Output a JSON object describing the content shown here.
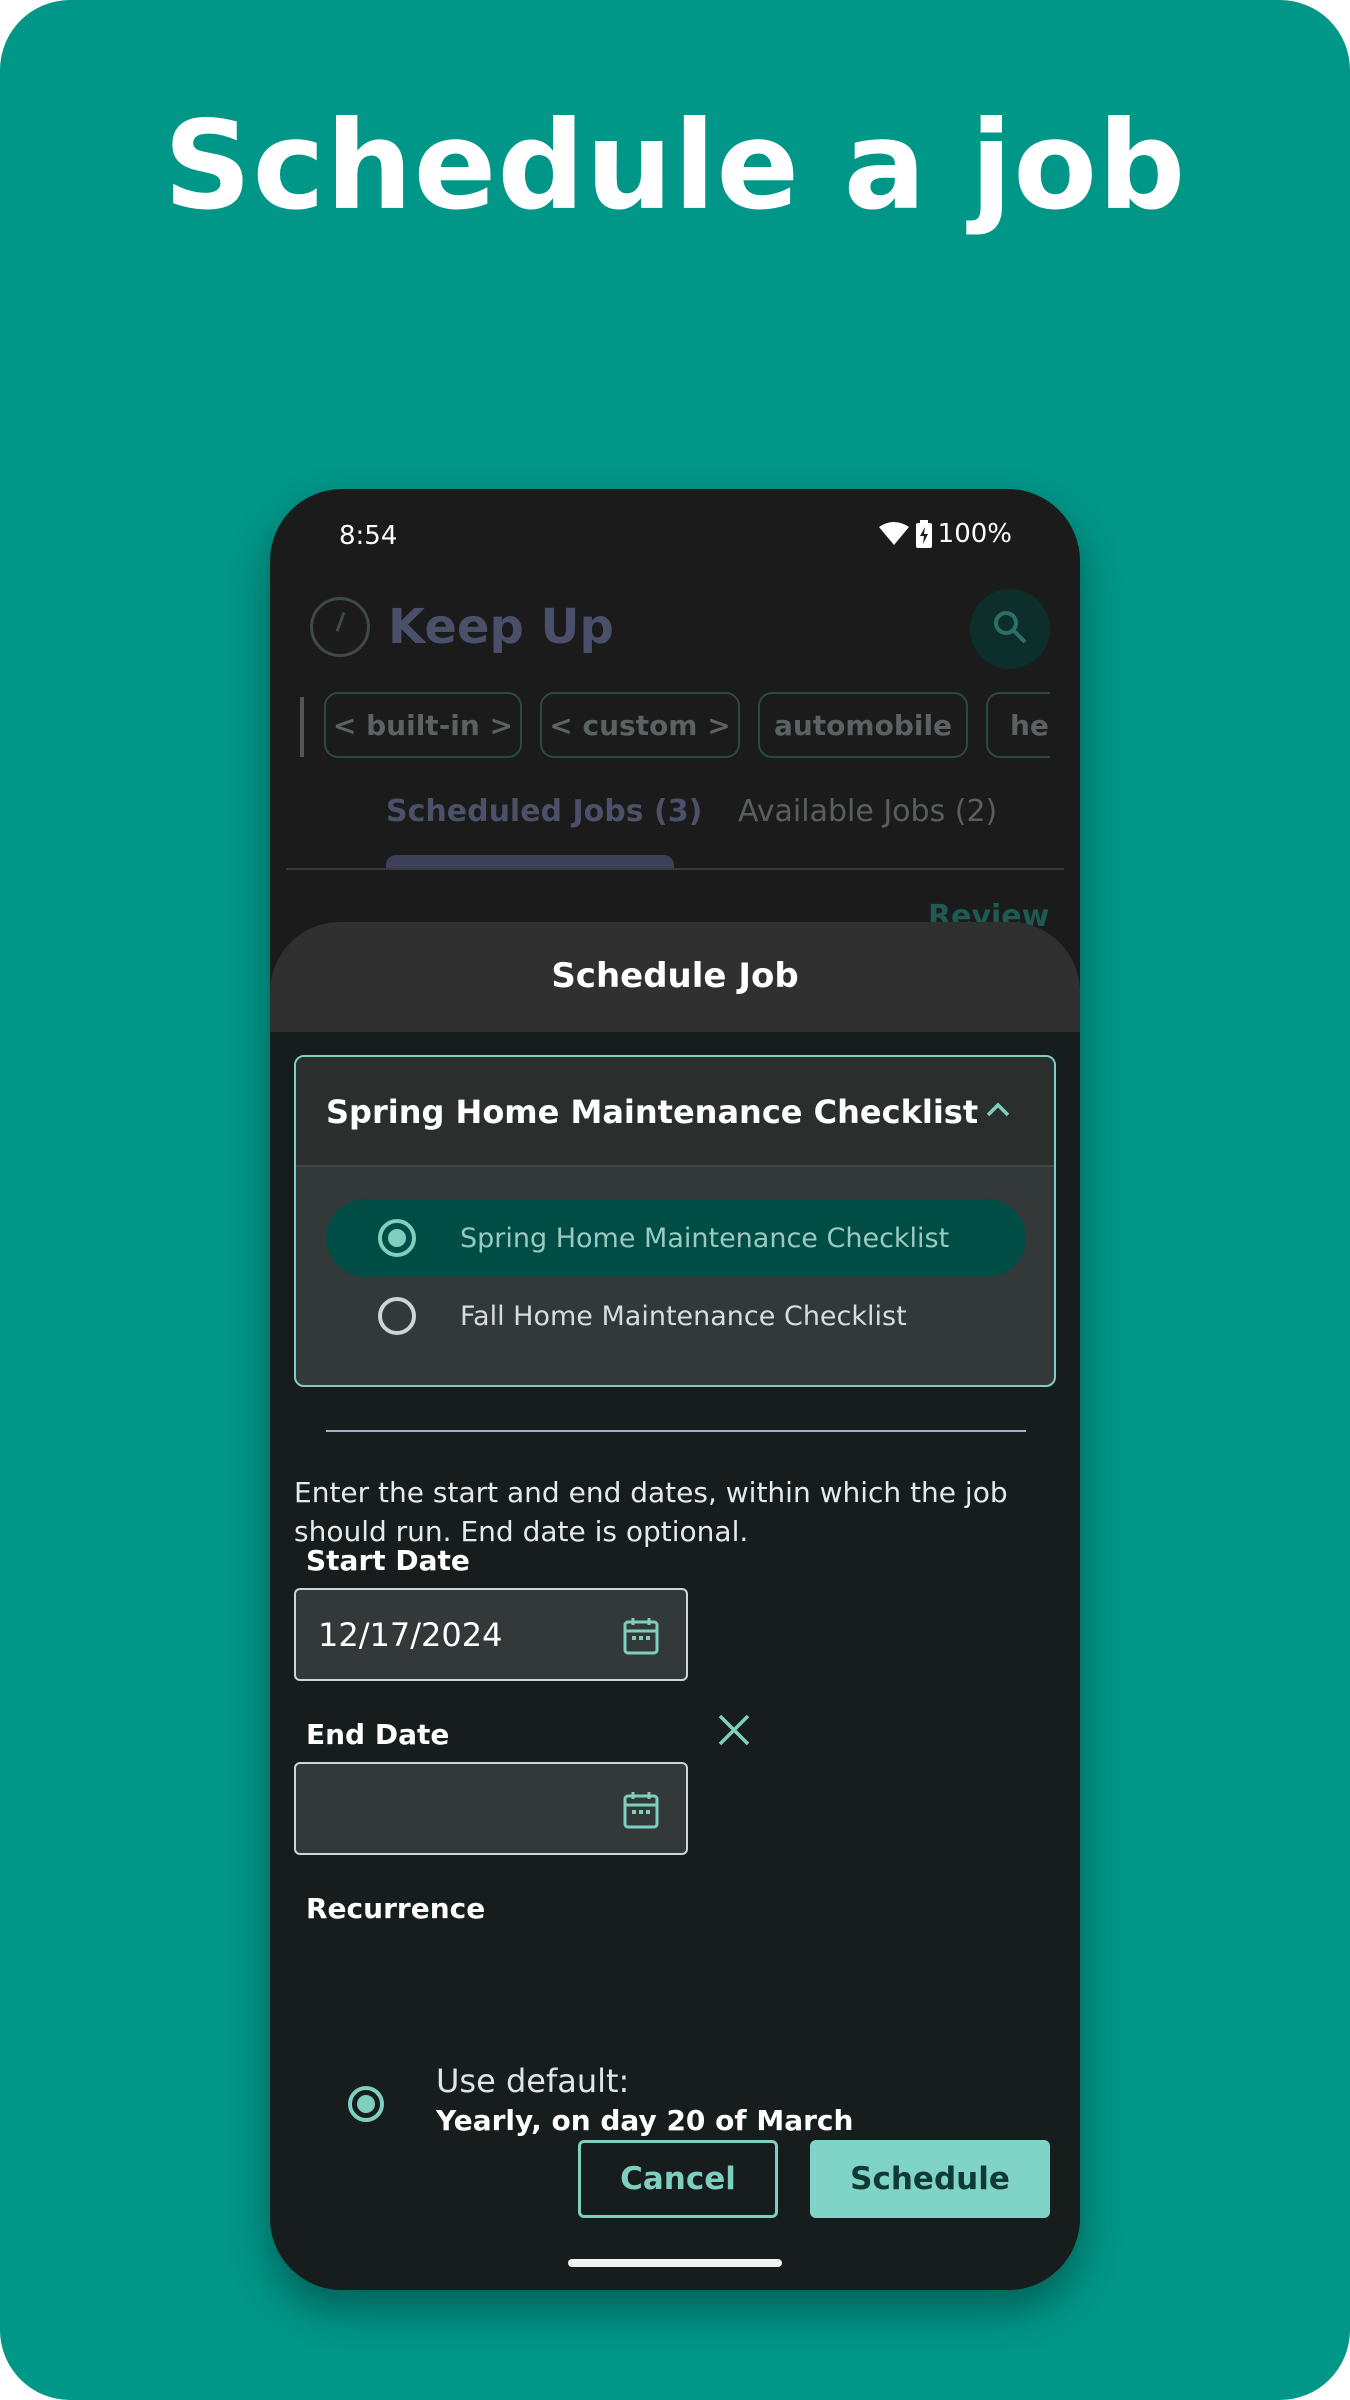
{
  "headline": "Schedule a job",
  "status_bar": {
    "time": "8:54",
    "battery": "100%"
  },
  "app": {
    "title": "Keep Up",
    "chips": [
      "< built-in >",
      "< custom >",
      "automobile",
      "hea"
    ],
    "tabs": [
      {
        "label": "Scheduled Jobs (3)",
        "active": true
      },
      {
        "label": "Available Jobs (2)",
        "active": false
      }
    ],
    "peek_action": "Review"
  },
  "sheet": {
    "title": "Schedule Job",
    "dropdown": {
      "selected_label": "Spring Home Maintenance Checklist",
      "options": [
        {
          "label": "Spring Home Maintenance Checklist",
          "selected": true
        },
        {
          "label": "Fall Home Maintenance Checklist",
          "selected": false
        }
      ]
    },
    "instructions": "Enter the start and end dates, within which the job should run.  End date is optional.",
    "start_date": {
      "label": "Start Date",
      "value": "12/17/2024"
    },
    "end_date": {
      "label": "End Date",
      "value": ""
    },
    "recurrence": {
      "label": "Recurrence",
      "option_title": "Use default:",
      "option_detail": "Yearly, on day 20 of March"
    },
    "buttons": {
      "cancel": "Cancel",
      "schedule": "Schedule"
    }
  },
  "colors": {
    "background": "#009688",
    "accent": "#7fcfc1",
    "selected_option": "#004d45",
    "schedule_button": "#80d4c7"
  }
}
